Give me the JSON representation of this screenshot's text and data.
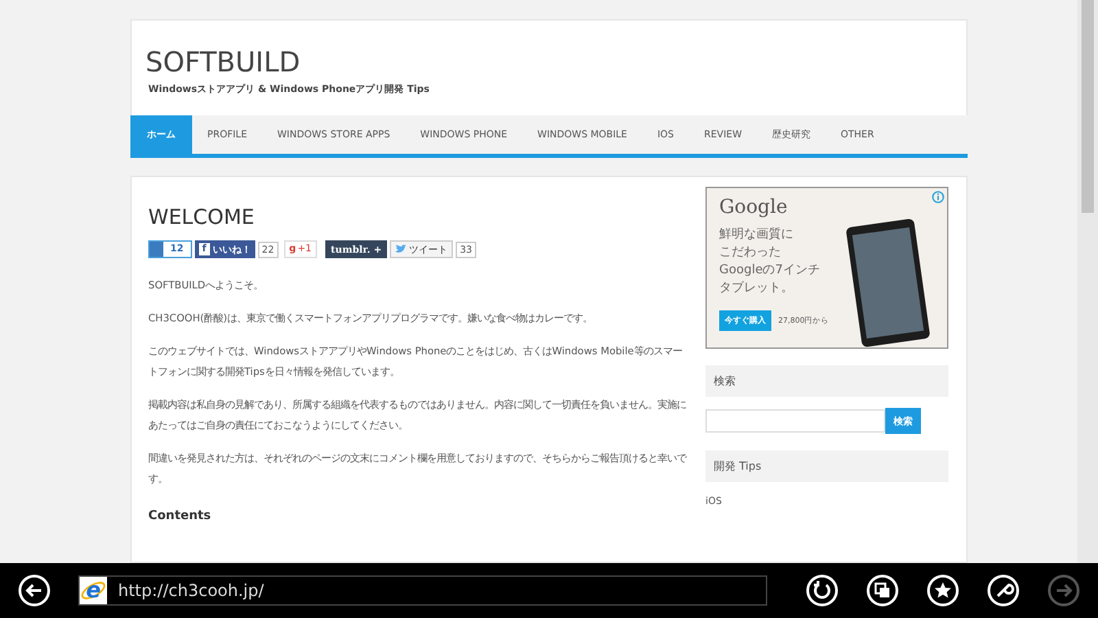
{
  "site": {
    "title": "SOFTBUILD",
    "tagline": "Windowsストアアプリ & Windows Phoneアプリ開発 Tips"
  },
  "nav": [
    {
      "label": "ホーム",
      "selected": true
    },
    {
      "label": "PROFILE",
      "selected": false
    },
    {
      "label": "WINDOWS STORE APPS",
      "selected": false
    },
    {
      "label": "WINDOWS PHONE",
      "selected": false
    },
    {
      "label": "WINDOWS MOBILE",
      "selected": false
    },
    {
      "label": "IOS",
      "selected": false
    },
    {
      "label": "REVIEW",
      "selected": false
    },
    {
      "label": "歴史研究",
      "selected": false
    },
    {
      "label": "OTHER",
      "selected": false
    }
  ],
  "article": {
    "heading": "WELCOME",
    "share": {
      "hatena_count": "12",
      "facebook_glyph": "f",
      "gplus_glyph": "g",
      "like_label": "いいね！",
      "like_count": "22",
      "gplus_label": "+1",
      "tumblr_label": "tumblr.",
      "tumblr_plus": "+",
      "tweet_label": "ツイート",
      "tweet_count": "33"
    },
    "paragraphs": [
      "SOFTBUILDへようこそ。",
      "CH3COOH(酢酸)は、東京で働くスマートフォンアプリプログラマです。嫌いな食べ物はカレーです。",
      "このウェブサイトでは、WindowsストアアプリやWindows Phoneのことをはじめ、古くはWindows Mobile等のスマートフォンに関する開発Tipsを日々情報を発信しています。",
      "掲載内容は私自身の見解であり、所属する組織を代表するものではありません。内容に関して一切責任を負いません。実施にあたってはご自身の責任にておこなうようにしてください。",
      "間違いを発見された方は、それぞれのページの文末にコメント欄を用意しておりますので、そちらからご報告頂けると幸いです。"
    ],
    "subheading": "Contents"
  },
  "ad": {
    "brand": "Google",
    "copy": [
      "鮮明な画質に",
      "こだわった",
      "Googleの7インチ",
      "タブレット。"
    ],
    "button": "今すぐ購入",
    "price": "27,800円から"
  },
  "search_widget": {
    "title": "検索",
    "button": "検索"
  },
  "tips_widget": {
    "title": "開発 Tips",
    "items": [
      "iOS"
    ]
  },
  "browser": {
    "logo_glyph": "e",
    "url": "http://ch3cooh.jp/",
    "forward_disabled": true
  }
}
